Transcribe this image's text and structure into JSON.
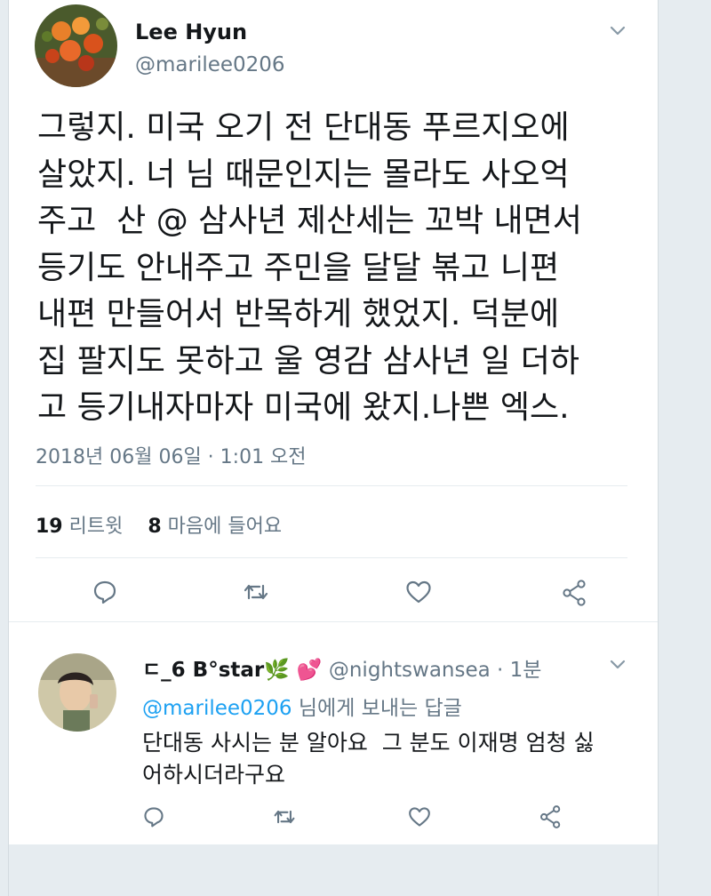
{
  "main_tweet": {
    "display_name": "Lee Hyun",
    "handle": "@marilee0206",
    "text_lines": [
      "그렇지. 미국 오기 전 단대동 푸르지오에",
      "살았지. 너 님 때문인지는 몰라도 사오억",
      "주고  산 @ 삼사년 제산세는 꼬박 내면서",
      "등기도 안내주고 주민을 달달 볶고 니편",
      "내편 만들어서 반목하게 했었지. 덕분에",
      "집 팔지도 못하고 울 영감 삼사년 일 더하",
      "고 등기내자마자 미국에 왔지.나쁜 엑스."
    ],
    "timestamp": "2018년 06월 06일 · 1:01 오전",
    "retweet_count": "19",
    "retweet_label": "리트윗",
    "like_count": "8",
    "like_label": "마음에 들어요"
  },
  "reply_tweet": {
    "display_name": "ㄷ_6 B°star🌿 💕",
    "handle": "@nightswansea",
    "time": "· 1분",
    "reply_to_handle": "@marilee0206",
    "reply_to_suffix": " 님에게 보내는 답글",
    "text_lines": [
      "단대동 사시는 분 알아요  그 분도 이재명 엄청 싫",
      "어하시더라구요"
    ]
  },
  "icons": {
    "reply": "reply-icon",
    "retweet": "retweet-icon",
    "like": "heart-icon",
    "share": "share-icon",
    "more": "chevron-down-icon"
  },
  "colors": {
    "link": "#1da1f2",
    "secondary_text": "#657786",
    "icon": "#657786",
    "background": "#e6ecf0"
  }
}
